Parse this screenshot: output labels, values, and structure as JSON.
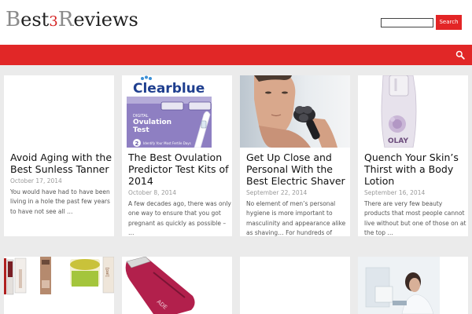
{
  "header": {
    "logo_first": "B",
    "logo_mid": "est",
    "logo_three": "3",
    "logo_r": "R",
    "logo_rest": "eviews",
    "search_placeholder": "",
    "search_button": "Search"
  },
  "colors": {
    "accent": "#e12727",
    "search_button": "#e32526",
    "page_bg": "#ebebeb"
  },
  "icons": {
    "nav_search": "search-icon"
  },
  "posts": [
    {
      "title": "Avoid Aging with the Best Sunless Tanner",
      "date": "October 17, 2014",
      "excerpt": "You would have had to have been living in a hole the past few years to have not see all …"
    },
    {
      "title": "The Best Ovulation Predictor Test Kits of 2014",
      "date": "October 8, 2014",
      "excerpt": "A few decades ago, there was only one way to ensure that you got pregnant as quickly as possible – …",
      "image_text": {
        "brand": "Clearblue",
        "product_small": "DIGITAL",
        "product_a": "Ovulation",
        "product_b": "Test",
        "badge": "2",
        "badge_text": "Identify Your Most Fertile Days"
      }
    },
    {
      "title": "Get Up Close and Personal With the Best Electric Shaver",
      "date": "September 22, 2014",
      "excerpt": "No element of men’s personal hygiene is more important to masculinity and appearance alike as shaving… For hundreds of years, …"
    },
    {
      "title": "Quench Your Skin’s Thirst with a Body Lotion",
      "date": "September 16, 2014",
      "excerpt": "There are very few beauty products that most people cannot live without but one of those on at the top …",
      "image_text": {
        "brand": "OLAY"
      }
    }
  ],
  "row2_image_text": {
    "jar_brand": "[pal]",
    "clipper_label": "ADE"
  }
}
